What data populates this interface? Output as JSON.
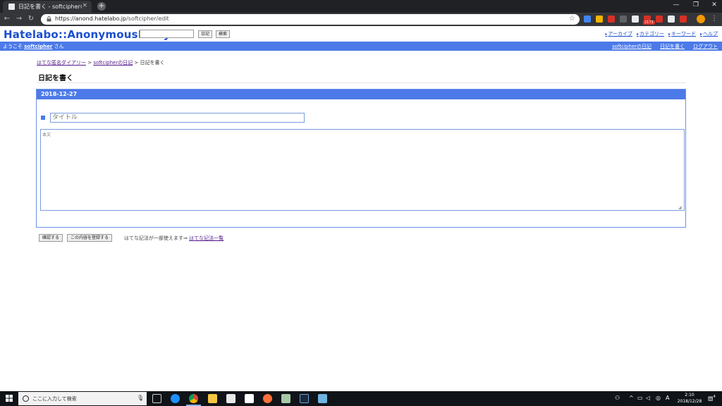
{
  "browser": {
    "tab_title": "日記を書く - softcipherの日記",
    "tab_close": "×",
    "new_tab": "+",
    "url_host": "https://anond.hatelabo.jp",
    "url_path": "/softcipher/edit",
    "ext_badge": "2173",
    "ext_colors": [
      "#4285f4",
      "#f4b400",
      "#d93025",
      "#5f6368",
      "#e8eaed",
      "#d93025",
      "#d93025",
      "#e8eaed",
      "#d93025"
    ]
  },
  "header": {
    "logo": "Hatelabo::AnonymousDiary",
    "search_value": "",
    "diary_button": "日記",
    "search_button": "検索",
    "links": [
      "アーカイブ",
      "カテゴリー",
      "キーワード",
      "ヘルプ"
    ]
  },
  "userbar": {
    "welcome_prefix": "ようこそ ",
    "username": "softcipher",
    "welcome_suffix": " さん",
    "links": [
      "softcipherの日記",
      "日記を書く",
      "ログアウト"
    ]
  },
  "breadcrumb": {
    "root": "はてな匿名ダイアリー",
    "sep": " > ",
    "diary": "softcipherの日記",
    "current": "日記を書く"
  },
  "page_title": "日記を書く",
  "entry": {
    "date": "2018-12-27",
    "title_placeholder": "タイトル",
    "body_placeholder": "本文"
  },
  "actions": {
    "confirm": "確認する",
    "submit": "この内容を登録する",
    "note_text": "はてな記法が一部使えます⇒ ",
    "note_link": "はてな記法一覧"
  },
  "taskbar": {
    "search_placeholder": "ここに入力して検索",
    "time": "2:10",
    "date": "2018/12/28",
    "notif_count": "4"
  }
}
